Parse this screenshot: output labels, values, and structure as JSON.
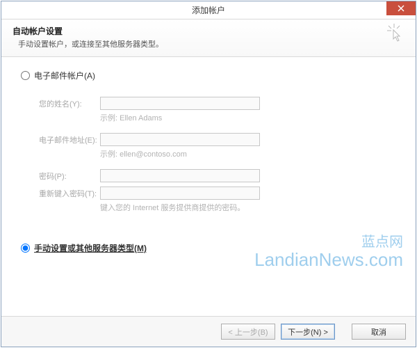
{
  "window": {
    "title": "添加帐户"
  },
  "header": {
    "title": "自动帐户设置",
    "subtitle": "手动设置帐户，或连接至其他服务器类型。"
  },
  "options": {
    "email_label": "电子邮件帐户(A)",
    "manual_label": "手动设置或其他服务器类型(M)"
  },
  "form": {
    "name_label": "您的姓名(Y):",
    "name_value": "",
    "name_example": "示例: Ellen Adams",
    "email_label": "电子邮件地址(E):",
    "email_value": "",
    "email_example": "示例: ellen@contoso.com",
    "password_label": "密码(P):",
    "password_value": "",
    "retype_label": "重新键入密码(T):",
    "retype_value": "",
    "password_hint": "键入您的 Internet 服务提供商提供的密码。"
  },
  "footer": {
    "back": "< 上一步(B)",
    "next": "下一步(N) >",
    "cancel": "取消"
  },
  "watermark": {
    "cn": "蓝点网",
    "en": "LandianNews.com"
  }
}
